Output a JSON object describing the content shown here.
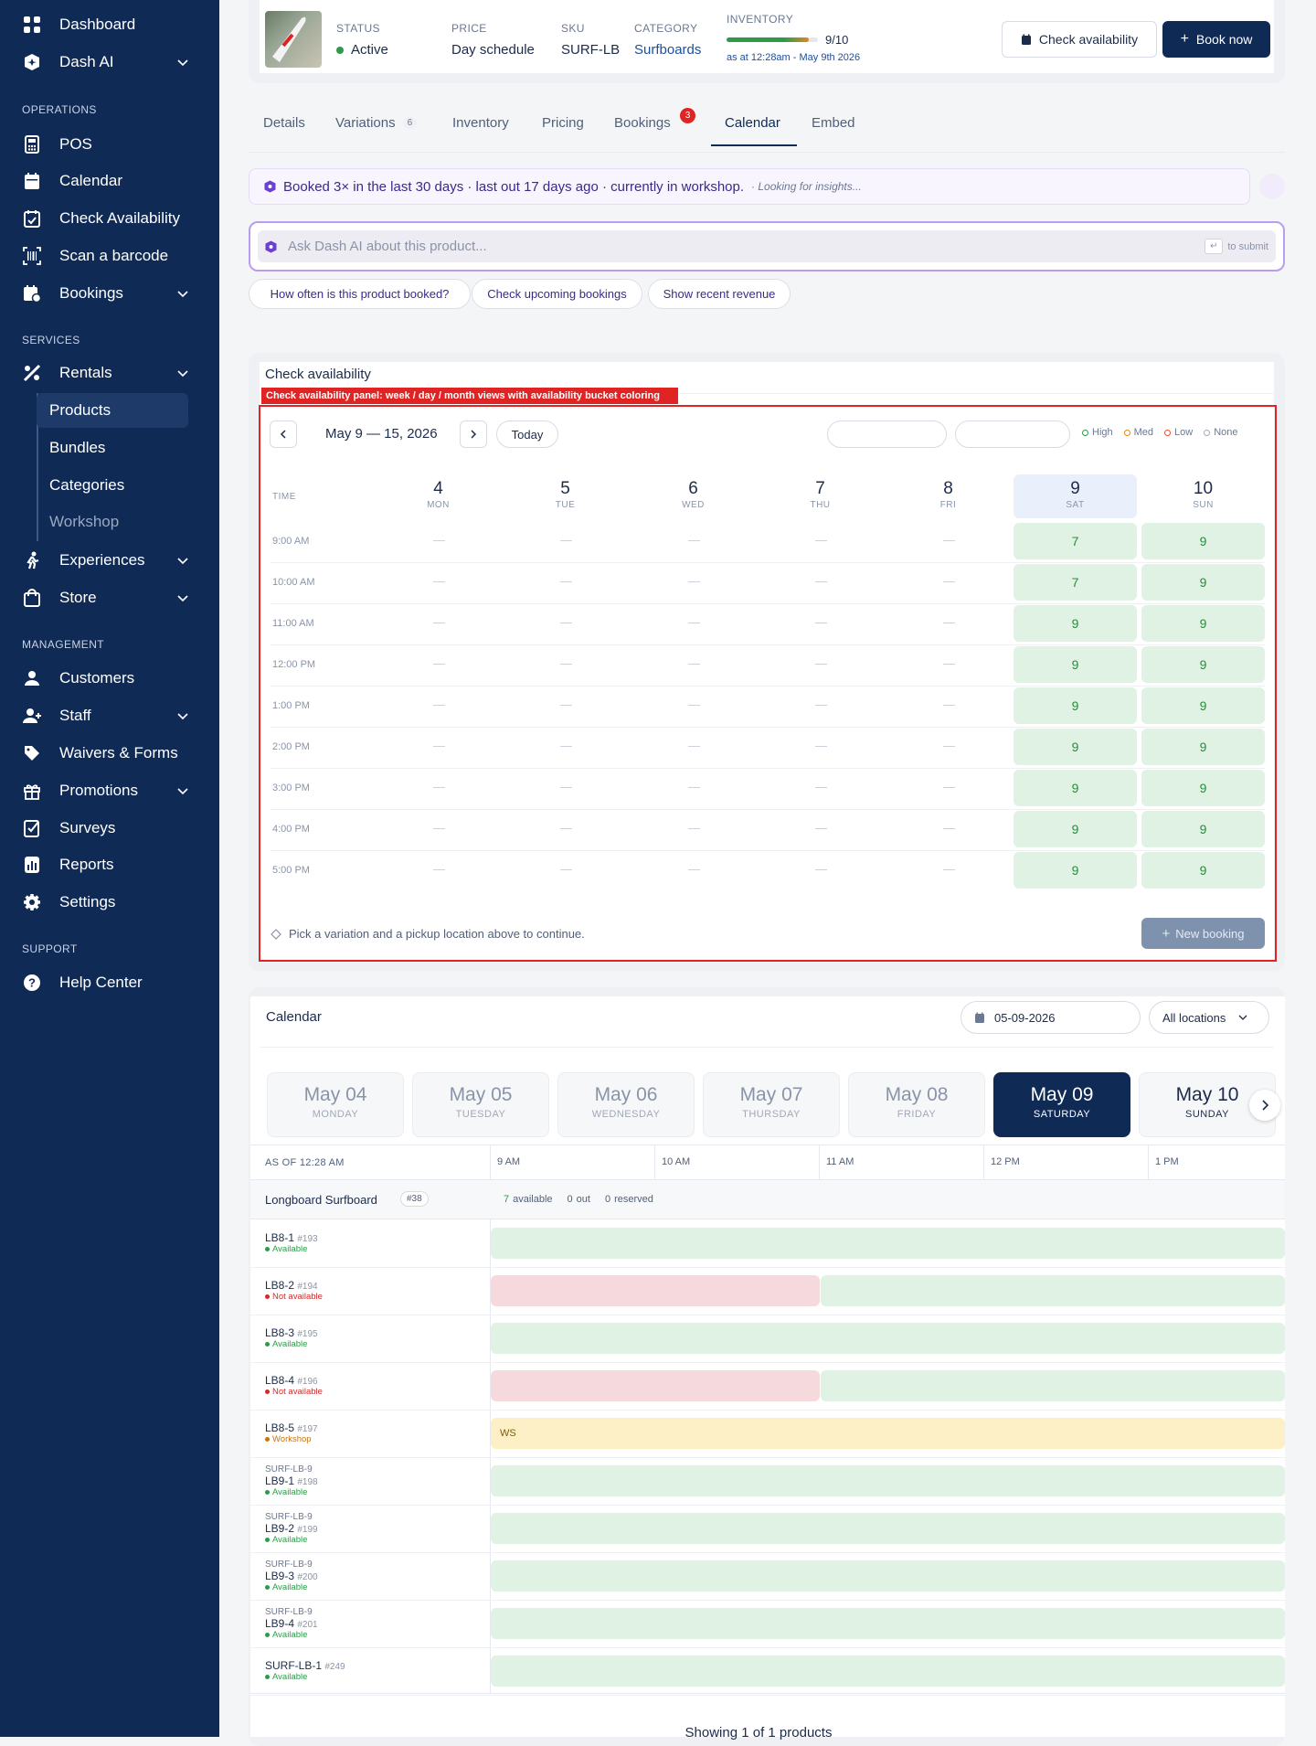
{
  "sidebar": {
    "top": [
      {
        "label": "Dashboard",
        "icon": "grid-icon"
      },
      {
        "label": "Dash AI",
        "icon": "dash-ai-icon"
      }
    ],
    "sections": {
      "operations": "OPERATIONS",
      "services": "SERVICES",
      "management": "MANAGEMENT",
      "support": "SUPPORT"
    },
    "operations": [
      {
        "label": "POS"
      },
      {
        "label": "Calendar"
      },
      {
        "label": "Check Availability"
      },
      {
        "label": "Scan a barcode"
      },
      {
        "label": "Bookings"
      }
    ],
    "services": [
      {
        "label": "Rentals"
      }
    ],
    "rentals_sub": [
      {
        "label": "Products"
      },
      {
        "label": "Bundles"
      },
      {
        "label": "Categories"
      },
      {
        "label": "Workshop"
      }
    ],
    "services2": [
      {
        "label": "Experiences"
      },
      {
        "label": "Store"
      }
    ],
    "management": [
      {
        "label": "Customers"
      },
      {
        "label": "Staff"
      },
      {
        "label": "Waivers & Forms"
      },
      {
        "label": "Promotions"
      },
      {
        "label": "Surveys"
      },
      {
        "label": "Reports"
      },
      {
        "label": "Settings"
      }
    ],
    "support": [
      {
        "label": "Help Center"
      }
    ]
  },
  "product": {
    "status_label": "STATUS",
    "status": "Active",
    "price_label": "PRICE",
    "price": "Day schedule",
    "sku_label": "SKU",
    "sku": "SURF-LB",
    "category_label": "CATEGORY",
    "category": "Surfboards",
    "inventory_label": "INVENTORY",
    "inventory": "9/10",
    "inventory_fraction": 0.9,
    "inventory_asof": "as at 12:28am - May 9th 2026",
    "check_availability": "Check availability",
    "book_now": "Book now"
  },
  "tabs": [
    {
      "label": "Details"
    },
    {
      "label": "Variations",
      "count": "6"
    },
    {
      "label": "Inventory"
    },
    {
      "label": "Pricing"
    },
    {
      "label": "Bookings",
      "badge": "3"
    },
    {
      "label": "Calendar"
    },
    {
      "label": "Embed"
    }
  ],
  "insight": {
    "text": "Booked 3× in the last 30 days · last out 17 days ago · currently in workshop.",
    "loading": "· Looking for insights..."
  },
  "ask": {
    "placeholder": "Ask Dash AI about this product...",
    "submit": "to submit"
  },
  "suggestions": [
    "How often is this product booked?",
    "Check upcoming bookings",
    "Show recent revenue"
  ],
  "availability": {
    "title": "Check availability",
    "annotation": "Check availability panel: week / day / month views with availability bucket coloring",
    "range": "May 9 — 15, 2026",
    "today": "Today",
    "legend": [
      {
        "label": "High",
        "color": "#2d9a4a"
      },
      {
        "label": "Med",
        "color": "#e08a1e"
      },
      {
        "label": "Low",
        "color": "#e0522a"
      },
      {
        "label": "None",
        "color": "#a0a8b8"
      }
    ],
    "time_header": "TIME",
    "days": [
      {
        "num": "4",
        "dow": "MON"
      },
      {
        "num": "5",
        "dow": "TUE"
      },
      {
        "num": "6",
        "dow": "WED"
      },
      {
        "num": "7",
        "dow": "THU"
      },
      {
        "num": "8",
        "dow": "FRI"
      },
      {
        "num": "9",
        "dow": "SAT"
      },
      {
        "num": "10",
        "dow": "SUN"
      }
    ],
    "times": [
      "9:00 AM",
      "10:00 AM",
      "11:00 AM",
      "12:00 PM",
      "1:00 PM",
      "2:00 PM",
      "3:00 PM",
      "4:00 PM",
      "5:00 PM"
    ],
    "sat": [
      "7",
      "7",
      "9",
      "9",
      "9",
      "9",
      "9",
      "9",
      "9"
    ],
    "sun": [
      "9",
      "9",
      "9",
      "9",
      "9",
      "9",
      "9",
      "9",
      "9"
    ],
    "empty": "—",
    "hint": "Pick a variation and a pickup location above to continue.",
    "new_booking": "New booking"
  },
  "calendar": {
    "title": "Calendar",
    "date": "05-09-2026",
    "location": "All locations",
    "days": [
      {
        "m": "May 04",
        "w": "MONDAY"
      },
      {
        "m": "May 05",
        "w": "TUESDAY"
      },
      {
        "m": "May 06",
        "w": "WEDNESDAY"
      },
      {
        "m": "May 07",
        "w": "THURSDAY"
      },
      {
        "m": "May 08",
        "w": "FRIDAY"
      },
      {
        "m": "May 09",
        "w": "SATURDAY"
      },
      {
        "m": "May 10",
        "w": "SUNDAY"
      }
    ],
    "asof": "AS OF 12:28 AM",
    "hours": [
      "9 AM",
      "10 AM",
      "11 AM",
      "12 PM",
      "1 PM"
    ],
    "group": {
      "name": "Longboard Surfboard",
      "count": "#38",
      "available": "7",
      "available_label": "available",
      "out": "0",
      "out_label": "out",
      "reserved": "0",
      "reserved_label": "reserved"
    },
    "rows": [
      {
        "prefix": "",
        "name": "LB8-1",
        "id": "#193",
        "status": "Available",
        "kind": "avail"
      },
      {
        "prefix": "",
        "name": "LB8-2",
        "id": "#194",
        "status": "Not available",
        "kind": "na"
      },
      {
        "prefix": "",
        "name": "LB8-3",
        "id": "#195",
        "status": "Available",
        "kind": "avail"
      },
      {
        "prefix": "",
        "name": "LB8-4",
        "id": "#196",
        "status": "Not available",
        "kind": "na"
      },
      {
        "prefix": "",
        "name": "LB8-5",
        "id": "#197",
        "status": "Workshop",
        "kind": "ws",
        "bar": "WS"
      },
      {
        "prefix": "SURF-LB-9",
        "name": "LB9-1",
        "id": "#198",
        "status": "Available",
        "kind": "avail"
      },
      {
        "prefix": "SURF-LB-9",
        "name": "LB9-2",
        "id": "#199",
        "status": "Available",
        "kind": "avail"
      },
      {
        "prefix": "SURF-LB-9",
        "name": "LB9-3",
        "id": "#200",
        "status": "Available",
        "kind": "avail"
      },
      {
        "prefix": "SURF-LB-9",
        "name": "LB9-4",
        "id": "#201",
        "status": "Available",
        "kind": "avail"
      },
      {
        "prefix": "",
        "name": "SURF-LB-1",
        "id": "#249",
        "status": "Available",
        "kind": "avail"
      }
    ],
    "footer": "Showing 1 of 1 products"
  }
}
